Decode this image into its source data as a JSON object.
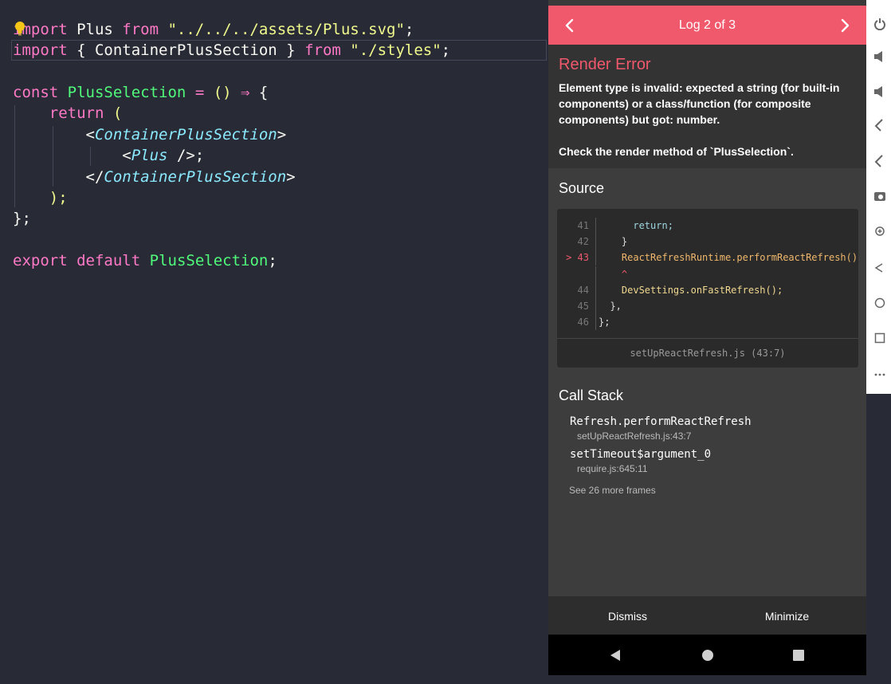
{
  "editor": {
    "lines": [
      [
        [
          "import",
          "kw"
        ],
        [
          " Plus ",
          ""
        ],
        [
          "from",
          "kw"
        ],
        [
          " \"../../../assets/Plus.svg\"",
          "str"
        ],
        [
          ";",
          ""
        ]
      ],
      [
        [
          "import",
          "kw"
        ],
        [
          " { ContainerPlusSection } ",
          ""
        ],
        [
          "from",
          "kw"
        ],
        [
          " \"./styles\"",
          "str"
        ],
        [
          ";",
          ""
        ]
      ],
      [],
      [
        [
          "const",
          "kw"
        ],
        [
          " ",
          ""
        ],
        [
          "PlusSelection",
          "fn"
        ],
        [
          " = ",
          "kw"
        ],
        [
          "()",
          "par"
        ],
        [
          " ⇒ ",
          "kw"
        ],
        [
          "{",
          ""
        ]
      ],
      [
        [
          "    return",
          "kw"
        ],
        [
          " (",
          "par"
        ]
      ],
      [
        [
          "        <",
          ""
        ],
        [
          "ContainerPlusSection",
          "cmp"
        ],
        [
          ">",
          ""
        ]
      ],
      [
        [
          "            <",
          ""
        ],
        [
          "Plus",
          "cmp"
        ],
        [
          " />;",
          ""
        ]
      ],
      [
        [
          "        </",
          ""
        ],
        [
          "ContainerPlusSection",
          "cmp"
        ],
        [
          ">",
          ""
        ]
      ],
      [
        [
          "    );",
          "par"
        ]
      ],
      [
        [
          "};",
          ""
        ]
      ],
      [],
      [
        [
          "export",
          "kw"
        ],
        [
          " ",
          ""
        ],
        [
          "default",
          "kw"
        ],
        [
          " ",
          ""
        ],
        [
          "PlusSelection",
          "fn"
        ],
        [
          ";",
          ""
        ]
      ]
    ]
  },
  "logbox": {
    "header_title": "Log 2 of 3",
    "error_title": "Render Error",
    "error_message": "Element type is invalid: expected a string (for built-in components) or a class/function (for composite components) but got: number.",
    "error_check": "Check the render method of `PlusSelection`.",
    "source_title": "Source",
    "source_lines": [
      {
        "num": "41",
        "code": "      return;",
        "highlight": false
      },
      {
        "num": "42",
        "code": "    }",
        "highlight": false
      },
      {
        "num": "> 43",
        "code": "    ReactRefreshRuntime.performReactRefresh();",
        "highlight": true
      },
      {
        "num": "",
        "code": "    ^",
        "highlight": false,
        "caret": true
      },
      {
        "num": "44",
        "code": "    DevSettings.onFastRefresh();",
        "highlight": false
      },
      {
        "num": "45",
        "code": "  },",
        "highlight": false
      },
      {
        "num": "46",
        "code": "};",
        "highlight": false
      }
    ],
    "source_file": "setUpReactRefresh.js (43:7)",
    "callstack_title": "Call Stack",
    "frames": [
      {
        "name": "Refresh.performReactRefresh",
        "location": "setUpReactRefresh.js:43:7"
      },
      {
        "name": "setTimeout$argument_0",
        "location": "require.js:645:11"
      }
    ],
    "more_frames": "See 26 more frames",
    "dismiss_label": "Dismiss",
    "minimize_label": "Minimize"
  },
  "colors": {
    "accent": "#f0586c",
    "editor_bg": "#282a36",
    "keyword": "#ff79c6",
    "string": "#f1fa8c",
    "function": "#50fa7b",
    "component": "#8be9fd"
  },
  "icons": {
    "header": [
      "chevron-left-icon",
      "chevron-right-icon"
    ],
    "nav": [
      "back-triangle-icon",
      "home-circle-icon",
      "recents-square-icon"
    ],
    "toolbar": [
      "power-icon",
      "volume-up-icon",
      "volume-down-icon",
      "rotate-left-icon",
      "rotate-right-icon",
      "camera-icon",
      "zoom-icon",
      "back-icon",
      "home-icon",
      "overview-icon",
      "more-icon"
    ],
    "editor": [
      "lightbulb-icon"
    ]
  }
}
